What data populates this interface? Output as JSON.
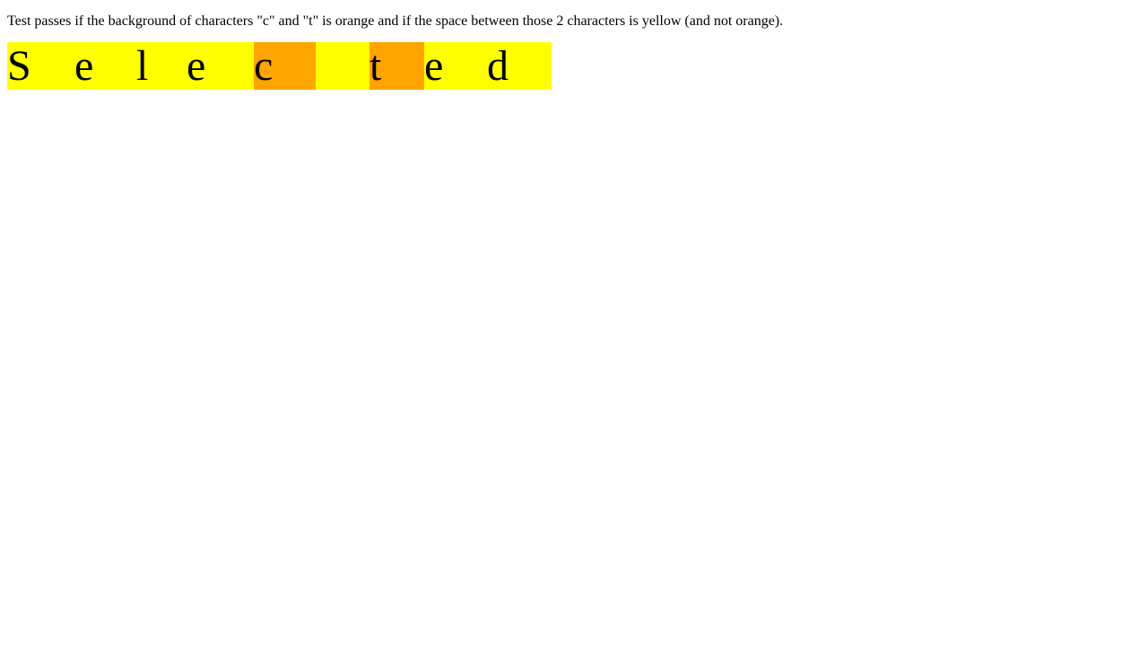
{
  "instructions": "Test passes if the background of characters \"c\" and \"t\" is orange and if the space between those 2 characters is yellow (and not orange).",
  "colors": {
    "text": "#000000",
    "page_background": "#ffffff",
    "yellow": "#ffff00",
    "orange": "#ffa500"
  },
  "test_text": {
    "chars": [
      {
        "char": "S",
        "highlight": "yellow"
      },
      {
        "char": "e",
        "highlight": "yellow"
      },
      {
        "char": "l",
        "highlight": "yellow"
      },
      {
        "char": "e",
        "highlight": "yellow"
      },
      {
        "char": "c",
        "highlight": "orange"
      },
      {
        "char": " ",
        "highlight": "yellow"
      },
      {
        "char": "t",
        "highlight": "orange"
      },
      {
        "char": "e",
        "highlight": "yellow"
      },
      {
        "char": "d",
        "highlight": "yellow"
      }
    ]
  }
}
